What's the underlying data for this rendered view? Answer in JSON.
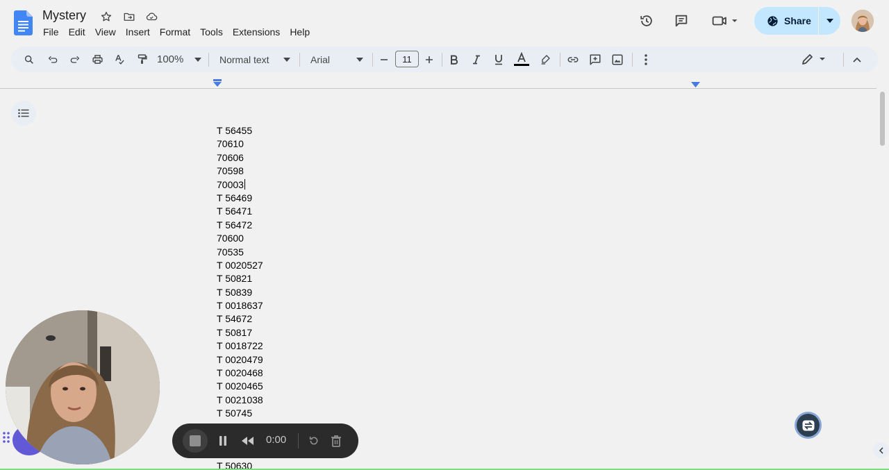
{
  "doc": {
    "title": "Mystery"
  },
  "menu": [
    "File",
    "Edit",
    "View",
    "Insert",
    "Format",
    "Tools",
    "Extensions",
    "Help"
  ],
  "header": {
    "share_label": "Share"
  },
  "toolbar": {
    "zoom": "100%",
    "style": "Normal text",
    "font": "Arial",
    "font_size": "11"
  },
  "document": {
    "lines": [
      "T 56455",
      "70610",
      "70606",
      "70598",
      "70003",
      "T 56469",
      "T 56471",
      "T 56472",
      "70600",
      "70535",
      "T 0020527",
      "T 50821",
      "T 50839",
      "T 0018637",
      "T 54672",
      "T 50817",
      "T 0018722",
      "T 0020479",
      "T 0020468",
      "T 0020465",
      "T 0021038",
      "T 50745"
    ],
    "caret_line": 4,
    "last_line": "T 50630"
  },
  "recorder": {
    "time": "0:00"
  },
  "colors": {
    "share_bg": "#c2e7ff",
    "toolbar_bg": "#e9edf4",
    "page_bg": "#f1f1f1",
    "docs_blue": "#4285f4"
  },
  "icons": {
    "logo": "google-docs-logo",
    "star": "star-icon",
    "move": "folder-move-icon",
    "cloud": "cloud-status-icon",
    "history": "history-icon",
    "comments": "comment-icon",
    "meet": "video-call-icon",
    "share": "globe-icon"
  }
}
